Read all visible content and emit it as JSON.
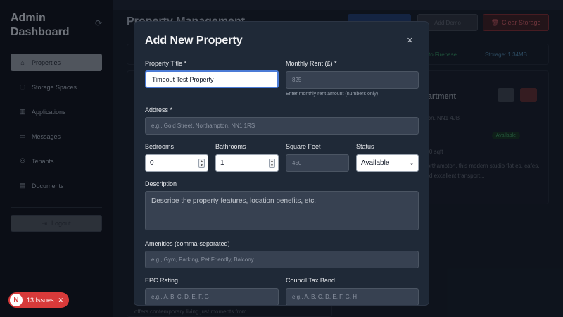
{
  "sidebar": {
    "brand": "Admin Dashboard",
    "refresh_icon": "refresh-icon",
    "items": [
      {
        "label": "Properties",
        "icon": "home-icon",
        "glyph": "⌂",
        "active": true
      },
      {
        "label": "Storage Spaces",
        "icon": "box-icon",
        "glyph": "▢"
      },
      {
        "label": "Applications",
        "icon": "building-icon",
        "glyph": "▥"
      },
      {
        "label": "Messages",
        "icon": "chat-icon",
        "glyph": "▭"
      },
      {
        "label": "Tenants",
        "icon": "users-icon",
        "glyph": "⚇"
      },
      {
        "label": "Documents",
        "icon": "document-icon",
        "glyph": "▤"
      }
    ],
    "logout": "Logout"
  },
  "header": {
    "title": "Property Management",
    "demo_label": "Add Demo",
    "clear_label": "Clear Storage"
  },
  "status": {
    "connection": "cted to Firebase",
    "storage": "Storage: 1.34MB"
  },
  "property_card": {
    "title": "partment",
    "location": "pton, NN1 4JB",
    "price": "h",
    "badge": "Available",
    "sqft": "300 sqft",
    "desc": "Northampton, this modern studio flat es, cafes, and excellent transport..."
  },
  "left_card": {
    "desc": "Located in the vibrant centre of Northampton, this stylish studio flat offers contemporary living just moments from..."
  },
  "issues": {
    "initial": "N",
    "label": "13 Issues"
  },
  "modal": {
    "title": "Add New Property",
    "fields": {
      "title_label": "Property Title *",
      "title_value": "Timeout Test Property",
      "rent_label": "Monthly Rent (£) *",
      "rent_placeholder": "825",
      "rent_hint": "Enter monthly rent amount (numbers only)",
      "address_label": "Address *",
      "address_placeholder": "e.g., Gold Street, Northampton, NN1 1RS",
      "bedrooms_label": "Bedrooms",
      "bedrooms_value": "0",
      "bathrooms_label": "Bathrooms",
      "bathrooms_value": "1",
      "sqft_label": "Square Feet",
      "sqft_placeholder": "450",
      "status_label": "Status",
      "status_value": "Available",
      "description_label": "Description",
      "description_placeholder": "Describe the property features, location benefits, etc.",
      "amenities_label": "Amenities (comma-separated)",
      "amenities_placeholder": "e.g., Gym, Parking, Pet Friendly, Balcony",
      "epc_label": "EPC Rating",
      "epc_placeholder": "e.g., A, B, C, D, E, F, G",
      "council_label": "Council Tax Band",
      "council_placeholder": "e.g., A, B, C, D, E, F, G, H"
    }
  }
}
